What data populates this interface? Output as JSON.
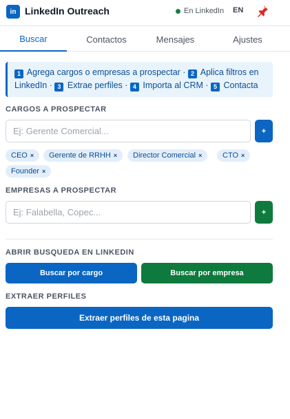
{
  "header": {
    "logo_text": "in",
    "title": "LinkedIn Outreach",
    "status_text": "En LinkedIn",
    "lang": "EN",
    "status_color": "#15803d",
    "brand_color": "#0a66c2"
  },
  "tabs": [
    {
      "label": "Buscar",
      "active": true
    },
    {
      "label": "Contactos",
      "active": false
    },
    {
      "label": "Mensajes",
      "active": false
    },
    {
      "label": "Ajustes",
      "active": false
    }
  ],
  "guide": {
    "steps": [
      {
        "num": "1",
        "text": "Agrega cargos o empresas a prospectar ·"
      },
      {
        "num": "2",
        "text": "Aplica filtros en LinkedIn ·"
      },
      {
        "num": "3",
        "text": "Extrae perfiles ·"
      },
      {
        "num": "4",
        "text": "Importa al CRM ·"
      },
      {
        "num": "5",
        "text": "Contacta"
      }
    ]
  },
  "cargos": {
    "label": "CARGOS A PROSPECTAR",
    "placeholder": "Ej: Gerente Comercial...",
    "add_label": "+",
    "chips": [
      "CEO",
      "Gerente de RRHH",
      "Director Comercial",
      "CTO",
      "Founder"
    ],
    "chip_remove": "×"
  },
  "empresas": {
    "label": "EMPRESAS A PROSPECTAR",
    "placeholder": "Ej: Falabella, Copec...",
    "add_label": "+"
  },
  "search": {
    "label": "ABRIR BUSQUEDA EN LINKEDIN",
    "by_role": "Buscar por cargo",
    "by_company": "Buscar por empresa"
  },
  "extract": {
    "label": "EXTRAER PERFILES",
    "button": "Extraer perfiles de esta pagina"
  }
}
